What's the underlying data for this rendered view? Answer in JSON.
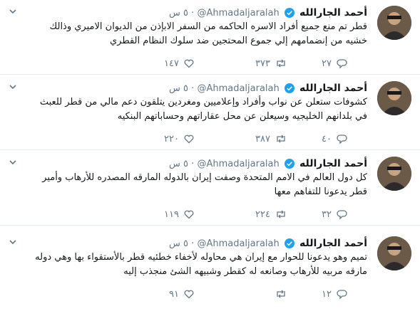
{
  "tweets": [
    {
      "name": "أحمد الجارالله",
      "handle": "@Ahmadaljaralah",
      "time": "٥ س",
      "text": "قطر تم منع جميع أفراد الاسره الحاكمه من السفر الابإذن من الديوان الاميري وذالك خشيه من إنضمامهم إلي جموع المحتجين ضد سلوك النظام القطري",
      "replies": "٢٧",
      "retweets": "٣٧٣",
      "likes": "١٤٧"
    },
    {
      "name": "أحمد الجارالله",
      "handle": "@Ahmadaljaralah",
      "time": "٥ س",
      "text": "كشوفات ستعلن عن نواب وأفراد وإعلاميين ومغردين يتلقون دعم مالي من قطر للعبث في بلدانهم الخليجيه وسيعلن عن محل عقاراتهم وحساباتهم البنكيه",
      "replies": "٤٠",
      "retweets": "٣٨٧",
      "likes": "٢٢٠"
    },
    {
      "name": "أحمد الجارالله",
      "handle": "@Ahmadaljaralah",
      "time": "٥ س",
      "text": "كل دول العالم في الامم المتحدة وصفت إيران بالدوله المارقه المصدره للأرهاب وأمير قطر يدعونا للتفاهم معها",
      "replies": "٣٢",
      "retweets": "٢٢٤",
      "likes": "١١٩"
    },
    {
      "name": "أحمد الجارالله",
      "handle": "@Ahmadaljaralah",
      "time": "٥ س",
      "text": "تميم وهو يدعونا للحوار مع إيران هي محاوله لأخفاء خطئيه قطر بالأستقواء بها وهي دوله مارقه مربيه للأرهاب وصانعه له كقطر وشبيهه الشئ منجذب إليه",
      "replies": "١٢",
      "retweets": "",
      "likes": "٩١"
    }
  ],
  "icons": {
    "verified": "verified-badge-icon",
    "caret": "chevron-down-icon",
    "reply": "reply-icon",
    "retweet": "retweet-icon",
    "like": "heart-icon"
  },
  "colors": {
    "verified": "#1da1f2",
    "muted": "#657786",
    "divider": "#e6ecf0"
  }
}
